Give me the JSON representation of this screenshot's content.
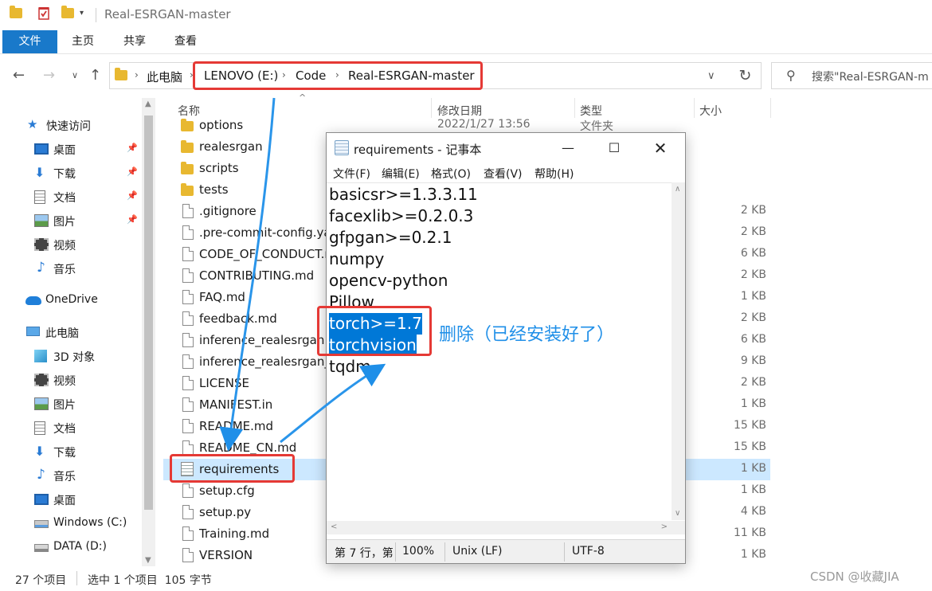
{
  "titlebar": {
    "title": "Real-ESRGAN-master"
  },
  "ribbon": {
    "tabs": [
      "文件",
      "主页",
      "共享",
      "查看"
    ]
  },
  "address": {
    "crumbs": [
      "此电脑",
      "LENOVO (E:)",
      "Code",
      "Real-ESRGAN-master"
    ],
    "search_placeholder": "搜索\"Real-ESRGAN-m"
  },
  "columns": {
    "name": "名称",
    "date": "修改日期",
    "type": "类型",
    "size": "大小"
  },
  "nav": {
    "quick_access": "快速访问",
    "quick_items": [
      "桌面",
      "下载",
      "文档",
      "图片",
      "视频",
      "音乐"
    ],
    "onedrive": "OneDrive",
    "this_pc": "此电脑",
    "pc_items": [
      "3D 对象",
      "视频",
      "图片",
      "文档",
      "下载",
      "音乐",
      "桌面",
      "Windows (C:)",
      "DATA (D:)"
    ]
  },
  "files": [
    {
      "name": "options",
      "date": "2022/1/27 13:56",
      "type": "文件夹",
      "size": "",
      "kind": "folder"
    },
    {
      "name": "realesrgan",
      "date": "",
      "type": "",
      "size": "",
      "kind": "folder"
    },
    {
      "name": "scripts",
      "date": "",
      "type": "",
      "size": "",
      "kind": "folder"
    },
    {
      "name": "tests",
      "date": "",
      "type": "",
      "size": "",
      "kind": "folder"
    },
    {
      "name": ".gitignore",
      "date": "",
      "type": "",
      "size": "2 KB",
      "kind": "doc"
    },
    {
      "name": ".pre-commit-config.ya",
      "date": "",
      "type": "",
      "size": "2 KB",
      "kind": "doc"
    },
    {
      "name": "CODE_OF_CONDUCT.m",
      "date": "",
      "type": "",
      "size": "6 KB",
      "kind": "doc"
    },
    {
      "name": "CONTRIBUTING.md",
      "date": "",
      "type": "",
      "size": "2 KB",
      "kind": "doc"
    },
    {
      "name": "FAQ.md",
      "date": "",
      "type": "",
      "size": "1 KB",
      "kind": "doc"
    },
    {
      "name": "feedback.md",
      "date": "",
      "type": "",
      "size": "2 KB",
      "kind": "doc"
    },
    {
      "name": "inference_realesrgan.",
      "date": "",
      "type": "",
      "size": "6 KB",
      "kind": "doc"
    },
    {
      "name": "inference_realesrgan_",
      "date": "",
      "type": "",
      "size": "9 KB",
      "kind": "doc"
    },
    {
      "name": "LICENSE",
      "date": "",
      "type": "",
      "size": "2 KB",
      "kind": "doc"
    },
    {
      "name": "MANIFEST.in",
      "date": "",
      "type": "",
      "size": "1 KB",
      "kind": "doc"
    },
    {
      "name": "README.md",
      "date": "",
      "type": "",
      "size": "15 KB",
      "kind": "doc"
    },
    {
      "name": "README_CN.md",
      "date": "",
      "type": "",
      "size": "15 KB",
      "kind": "doc"
    },
    {
      "name": "requirements",
      "date": "",
      "type": "",
      "size": "1 KB",
      "kind": "txt"
    },
    {
      "name": "setup.cfg",
      "date": "",
      "type": "",
      "size": "1 KB",
      "kind": "doc"
    },
    {
      "name": "setup.py",
      "date": "",
      "type": "",
      "size": "4 KB",
      "kind": "doc"
    },
    {
      "name": "Training.md",
      "date": "",
      "type": "",
      "size": "11 KB",
      "kind": "doc"
    },
    {
      "name": "VERSION",
      "date": "",
      "type": "",
      "size": "1 KB",
      "kind": "doc"
    }
  ],
  "status": {
    "count": "27 个项目",
    "selected": "选中 1 个项目  105 字节"
  },
  "notepad": {
    "title": "requirements - 记事本",
    "menus": [
      "文件(F)",
      "编辑(E)",
      "格式(O)",
      "查看(V)",
      "帮助(H)"
    ],
    "lines": [
      "basicsr>=1.3.3.11",
      "facexlib>=0.2.0.3",
      "gfpgan>=0.2.1",
      "numpy",
      "opencv-python",
      "Pillow",
      "torch>=1.7",
      "torchvision",
      "tqdm"
    ],
    "selected_lines": [
      6,
      7
    ],
    "status_pos": "第 7 行，第",
    "zoom": "100%",
    "eol": "Unix (LF)",
    "encoding": "UTF-8"
  },
  "annotation": {
    "text": "删除（已经安装好了）",
    "color": "#1f8fe8",
    "box_color": "#e53935"
  },
  "watermark": "CSDN @收藏JIA",
  "colors": {
    "accent": "#1979ca",
    "selection": "#0078d7",
    "row_selected": "#cce8ff",
    "folder": "#e8b830"
  }
}
